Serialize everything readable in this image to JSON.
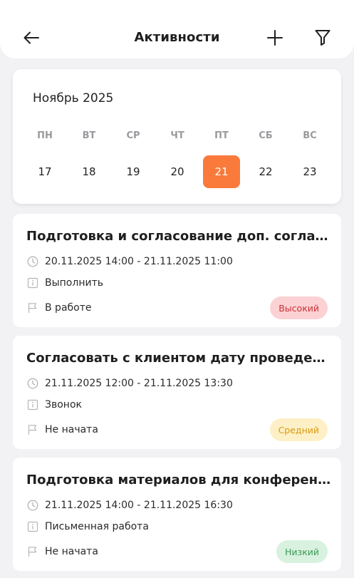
{
  "header": {
    "title": "Активности"
  },
  "calendar": {
    "month": "Ноябрь 2025",
    "weekdays": [
      "ПН",
      "ВТ",
      "СР",
      "ЧТ",
      "ПТ",
      "СБ",
      "ВС"
    ],
    "days": [
      "17",
      "18",
      "19",
      "20",
      "21",
      "22",
      "23"
    ],
    "selected_index": 4
  },
  "activities": [
    {
      "title": "Подготовка и согласование доп. соглашения",
      "time": "20.11.2025 14:00 - 21.11.2025 11:00",
      "type": "Выполнить",
      "status": "В работе",
      "priority": "Высокий"
    },
    {
      "title": "Согласовать с клиентом дату проведения...",
      "time": "21.11.2025 12:00 - 21.11.2025 13:30",
      "type": "Звонок",
      "status": "Не начата",
      "priority": "Средний"
    },
    {
      "title": "Подготовка материалов для конференции",
      "time": "21.11.2025 14:00 - 21.11.2025 16:30",
      "type": "Письменная работа",
      "status": "Не начата",
      "priority": "Низкий"
    }
  ],
  "colors": {
    "accent": "#fa7a3c",
    "high": "#c8313a",
    "medium": "#d79a10",
    "low": "#3a9a55"
  },
  "icons": {
    "back": "arrow-left-icon",
    "add": "plus-icon",
    "filter": "filter-icon",
    "time": "clock-icon",
    "type": "info-icon",
    "status": "flag-icon"
  }
}
